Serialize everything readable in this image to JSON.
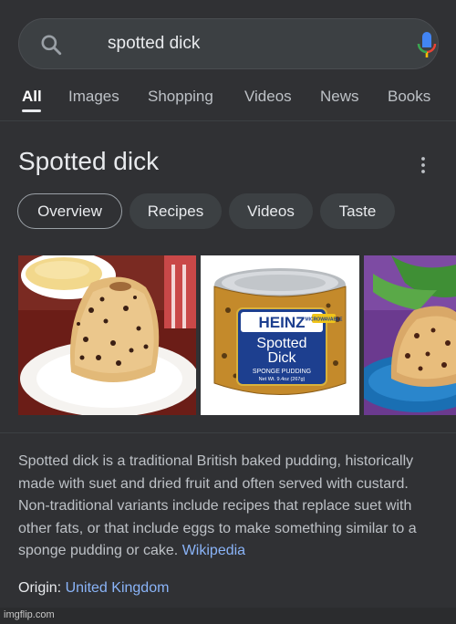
{
  "search": {
    "query": "spotted dick"
  },
  "tabs": [
    {
      "label": "All",
      "active": true
    },
    {
      "label": "Images"
    },
    {
      "label": "Shopping"
    },
    {
      "label": "Videos"
    },
    {
      "label": "News"
    },
    {
      "label": "Books"
    }
  ],
  "panel": {
    "title": "Spotted dick",
    "chips": [
      {
        "label": "Overview",
        "selected": true
      },
      {
        "label": "Recipes"
      },
      {
        "label": "Videos"
      },
      {
        "label": "Taste"
      }
    ],
    "images": [
      {
        "alt": "Spotted dick pudding with custard"
      },
      {
        "alt": "Heinz Spotted Dick sponge pudding can",
        "can_text": [
          "HEINZ",
          "Spotted",
          "Dick",
          "SPONGE PUDDING",
          "Net Wt. 9.4oz (267g)",
          "MICROWAVABLE"
        ]
      },
      {
        "alt": "Spotted dick on blue plate"
      }
    ],
    "description": "Spotted dick is a traditional British baked pudding, historically made with suet and dried fruit and often served with custard. Non-traditional variants include recipes that replace suet with other fats, or that include eggs to make something similar to a sponge pudding or cake.",
    "source_link": "Wikipedia",
    "origin_label": "Origin:",
    "origin_value": "United Kingdom"
  },
  "watermark": "imgflip.com",
  "colors": {
    "background": "#303134",
    "link": "#8ab4f8",
    "mic_blue": "#4285f4",
    "mic_red": "#ea4335"
  }
}
